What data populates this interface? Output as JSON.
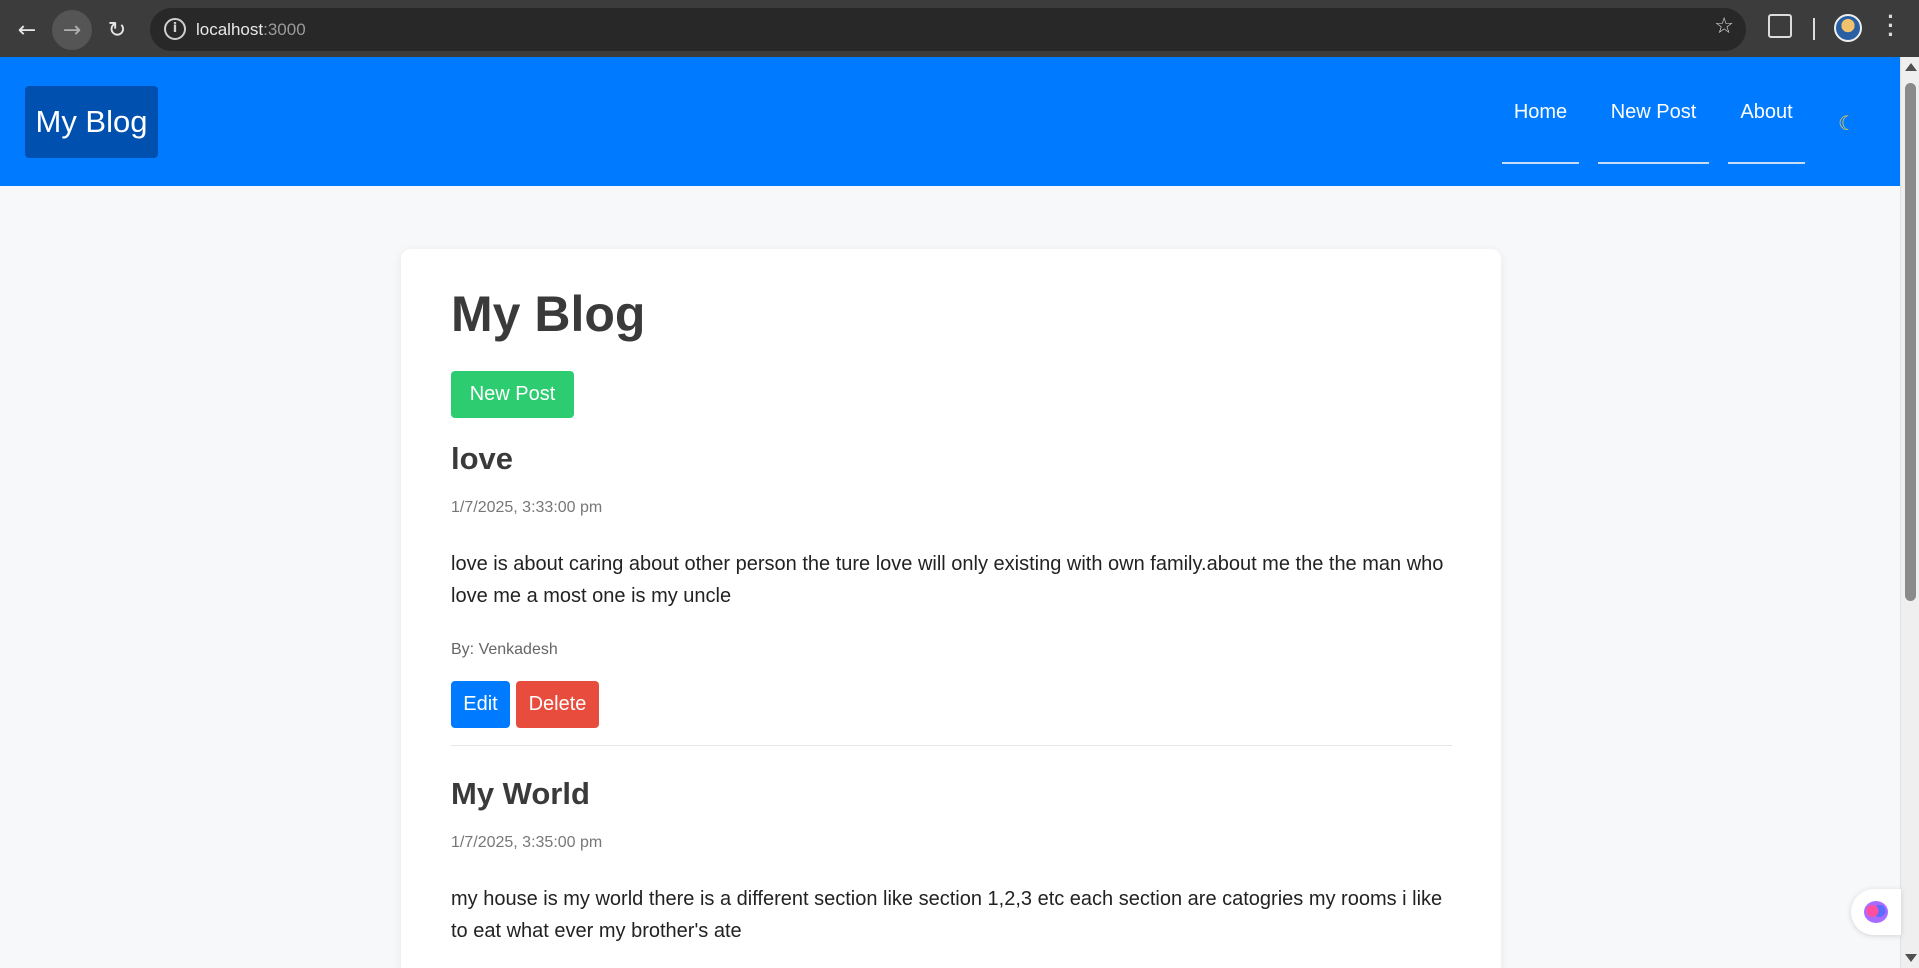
{
  "browser": {
    "url_host": "localhost",
    "url_port": ":3000",
    "icons": [
      "back-arrow-icon",
      "forward-arrow-icon",
      "reload-icon",
      "site-info-icon",
      "bookmark-star-icon",
      "extensions-icon",
      "profile-avatar",
      "more-menu-icon"
    ]
  },
  "header": {
    "brand": "My Blog",
    "nav": [
      {
        "label": "Home"
      },
      {
        "label": "New Post"
      },
      {
        "label": "About"
      }
    ],
    "theme_icon": "moon-icon",
    "colors": {
      "header_bg": "#007bff",
      "brand_bg": "#0050b0"
    }
  },
  "main": {
    "title": "My Blog",
    "new_post_label": "New Post",
    "posts": [
      {
        "title": "love",
        "date": "1/7/2025, 3:33:00 pm",
        "body": "love is about caring about other person the ture love will only existing with own family.about me the the man who love me a most one is my uncle",
        "author": "By: Venkadesh",
        "edit_label": "Edit",
        "delete_label": "Delete"
      },
      {
        "title": "My World",
        "date": "1/7/2025, 3:35:00 pm",
        "body": "my house is my world there is a different section like section 1,2,3 etc each section are catogries my rooms i like to eat what ever my brother's ate"
      }
    ],
    "colors": {
      "new_post": "#2ecc71",
      "edit": "#007bff",
      "delete": "#e74c3c"
    }
  },
  "widget": {
    "icon": "brain-icon"
  }
}
